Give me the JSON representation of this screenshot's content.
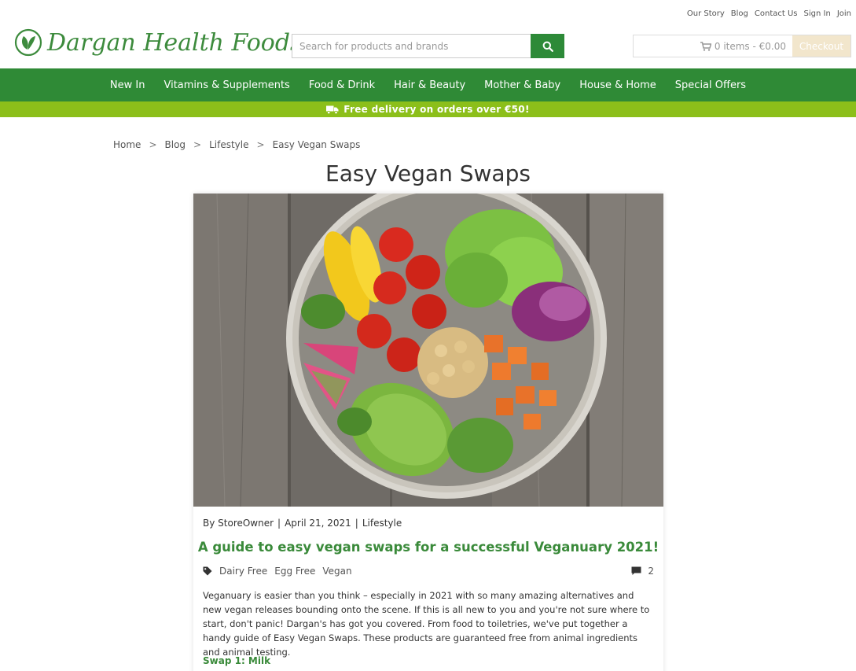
{
  "toplinks": [
    "Our Story",
    "Blog",
    "Contact Us",
    "Sign In",
    "Join"
  ],
  "brand": {
    "name": "Dargan Health Foods",
    "color": "#3d8b3d"
  },
  "search": {
    "placeholder": "Search for products and brands",
    "icon": "search-icon"
  },
  "cart": {
    "summary": "0 items - €0.00",
    "checkout": "Checkout",
    "icon": "cart-icon"
  },
  "nav": [
    "New In",
    "Vitamins & Supplements",
    "Food & Drink",
    "Hair & Beauty",
    "Mother & Baby",
    "House & Home",
    "Special Offers"
  ],
  "promo": {
    "text": "Free delivery on orders over €50!",
    "icon": "truck-icon"
  },
  "breadcrumb": [
    "Home",
    "Blog",
    "Lifestyle",
    "Easy Vegan Swaps"
  ],
  "breadcrumb_sep": ">",
  "page_title": "Easy Vegan Swaps",
  "post": {
    "author": "By StoreOwner",
    "date": "April 21, 2021",
    "category": "Lifestyle",
    "sep": "|",
    "title": "A guide to easy vegan swaps for a successful Veganuary 2021!",
    "tags": [
      "Dairy Free",
      "Egg Free",
      "Vegan"
    ],
    "comments": "2",
    "body": "Veganuary is easier than you think – especially in 2021 with so many amazing alternatives and new vegan releases bounding onto the scene. If this is all new to you and you're not sure where to start, don't panic! Dargan's has got you covered. From food to toiletries, we've put together a handy guide of Easy Vegan Swaps. These products are guaranteed free from animal ingredients and animal testing.",
    "subheading": "Swap 1: Milk"
  },
  "colors": {
    "primary_green": "#2f8a36",
    "lime": "#8cbf1a",
    "checkout_bg": "#f2e6cc"
  }
}
